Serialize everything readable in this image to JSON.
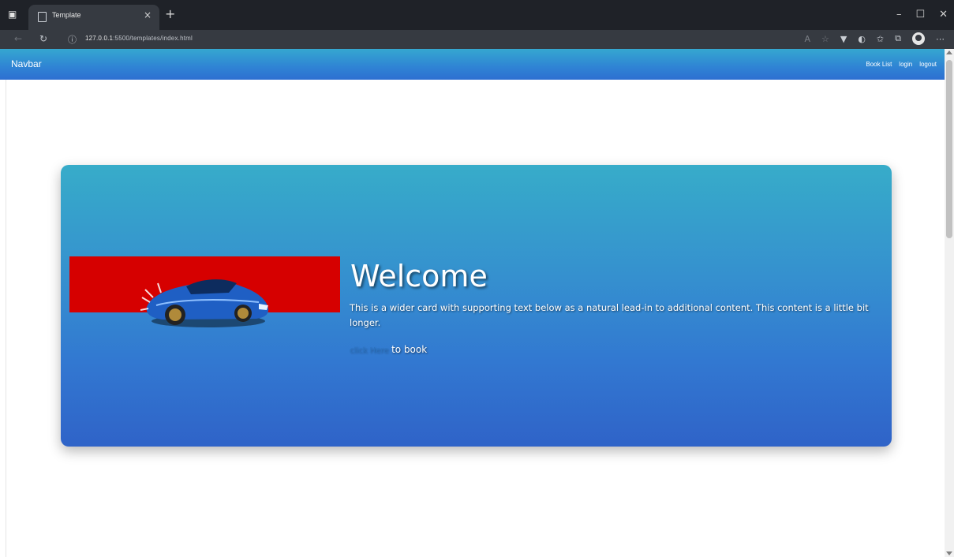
{
  "browser": {
    "tab_title": "Template",
    "tab_close": "×",
    "new_tab": "+",
    "url_host": "127.0.0.1",
    "url_path": ":5500/templates/index.html",
    "window_controls": {
      "minimize": "–",
      "maximize": "☐",
      "close": "✕"
    }
  },
  "navbar": {
    "brand": "Navbar",
    "links": [
      "Book List",
      "login",
      "logout"
    ]
  },
  "card": {
    "title": "Welcome",
    "text": "This is a wider card with supporting text below as a natural lead-in to additional content. This content is a little bit longer.",
    "cta_link": "click Here",
    "cta_suffix": "to book"
  },
  "colors": {
    "navbar_gradient_top": "#35a7d0",
    "navbar_gradient_bottom": "#2e6fd1",
    "card_gradient_top": "#37acc9",
    "card_gradient_bottom": "#2f63c8",
    "image_band": "#d60000",
    "car_body": "#1f5fc4"
  }
}
